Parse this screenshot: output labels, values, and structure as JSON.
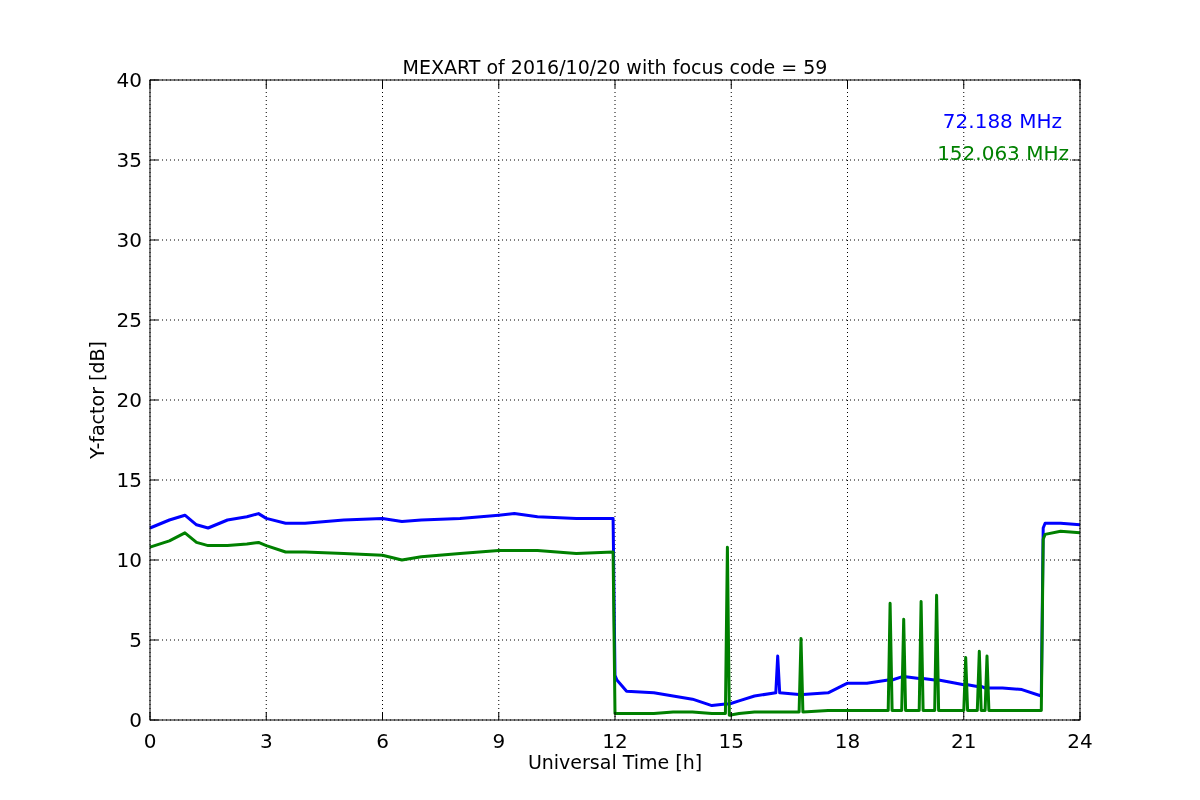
{
  "chart_data": {
    "type": "line",
    "title": "MEXART of 2016/10/20 with focus code = 59",
    "xlabel": "Universal Time [h]",
    "ylabel": "Y-factor [dB]",
    "x": [
      0,
      0.5,
      0.9,
      1.2,
      1.5,
      2,
      2.5,
      2.8,
      3,
      3.5,
      4,
      5,
      6,
      6.5,
      7,
      8,
      9,
      9.4,
      10,
      11,
      11.95,
      12.0,
      12.05,
      12.3,
      13,
      13.5,
      14,
      14.5,
      14.85,
      14.9,
      14.95,
      15.2,
      15.6,
      16.15,
      16.2,
      16.25,
      16.75,
      16.8,
      16.85,
      17.5,
      18,
      18.5,
      19.05,
      19.1,
      19.15,
      19.4,
      19.45,
      19.5,
      19.85,
      19.9,
      19.95,
      20.25,
      20.3,
      20.35,
      20.8,
      21.0,
      21.05,
      21.1,
      21.35,
      21.4,
      21.45,
      21.55,
      21.6,
      21.65,
      22,
      22.5,
      23.0,
      23.05,
      23.1,
      23.5,
      24
    ],
    "series": [
      {
        "name": "72.188 MHz",
        "color": "#0000ff",
        "values": [
          12.0,
          12.5,
          12.8,
          12.2,
          12.0,
          12.5,
          12.7,
          12.9,
          12.6,
          12.3,
          12.3,
          12.5,
          12.6,
          12.4,
          12.5,
          12.6,
          12.8,
          12.9,
          12.7,
          12.6,
          12.6,
          2.8,
          2.5,
          1.8,
          1.7,
          1.5,
          1.3,
          0.9,
          1.0,
          1.0,
          1.0,
          1.2,
          1.5,
          1.7,
          4.0,
          1.7,
          1.6,
          1.6,
          1.6,
          1.7,
          2.3,
          2.3,
          2.5,
          2.5,
          2.5,
          2.7,
          2.7,
          2.7,
          2.6,
          2.6,
          2.6,
          2.5,
          2.5,
          2.5,
          2.3,
          2.2,
          2.2,
          2.2,
          2.1,
          2.1,
          2.1,
          2.0,
          2.0,
          2.0,
          2.0,
          1.9,
          1.5,
          12.0,
          12.3,
          12.3,
          12.2
        ]
      },
      {
        "name": "152.063 MHz",
        "color": "#008000",
        "values": [
          10.8,
          11.2,
          11.7,
          11.1,
          10.9,
          10.9,
          11.0,
          11.1,
          10.9,
          10.5,
          10.5,
          10.4,
          10.3,
          10.0,
          10.2,
          10.4,
          10.6,
          10.6,
          10.6,
          10.4,
          10.5,
          0.4,
          0.4,
          0.4,
          0.4,
          0.5,
          0.5,
          0.4,
          0.4,
          10.8,
          0.3,
          0.4,
          0.5,
          0.5,
          0.5,
          0.5,
          0.5,
          5.1,
          0.5,
          0.6,
          0.6,
          0.6,
          0.6,
          7.3,
          0.6,
          0.6,
          6.3,
          0.6,
          0.6,
          7.4,
          0.6,
          0.6,
          7.8,
          0.6,
          0.6,
          0.6,
          3.9,
          0.6,
          0.6,
          4.3,
          0.6,
          0.6,
          4.0,
          0.6,
          0.6,
          0.6,
          0.6,
          11.3,
          11.6,
          11.8,
          11.7
        ]
      }
    ],
    "xlim": [
      0,
      24
    ],
    "ylim": [
      0,
      40
    ],
    "xticks": [
      0,
      3,
      6,
      9,
      12,
      15,
      18,
      21,
      24
    ],
    "yticks": [
      0,
      5,
      10,
      15,
      20,
      25,
      30,
      35,
      40
    ],
    "grid": true
  }
}
